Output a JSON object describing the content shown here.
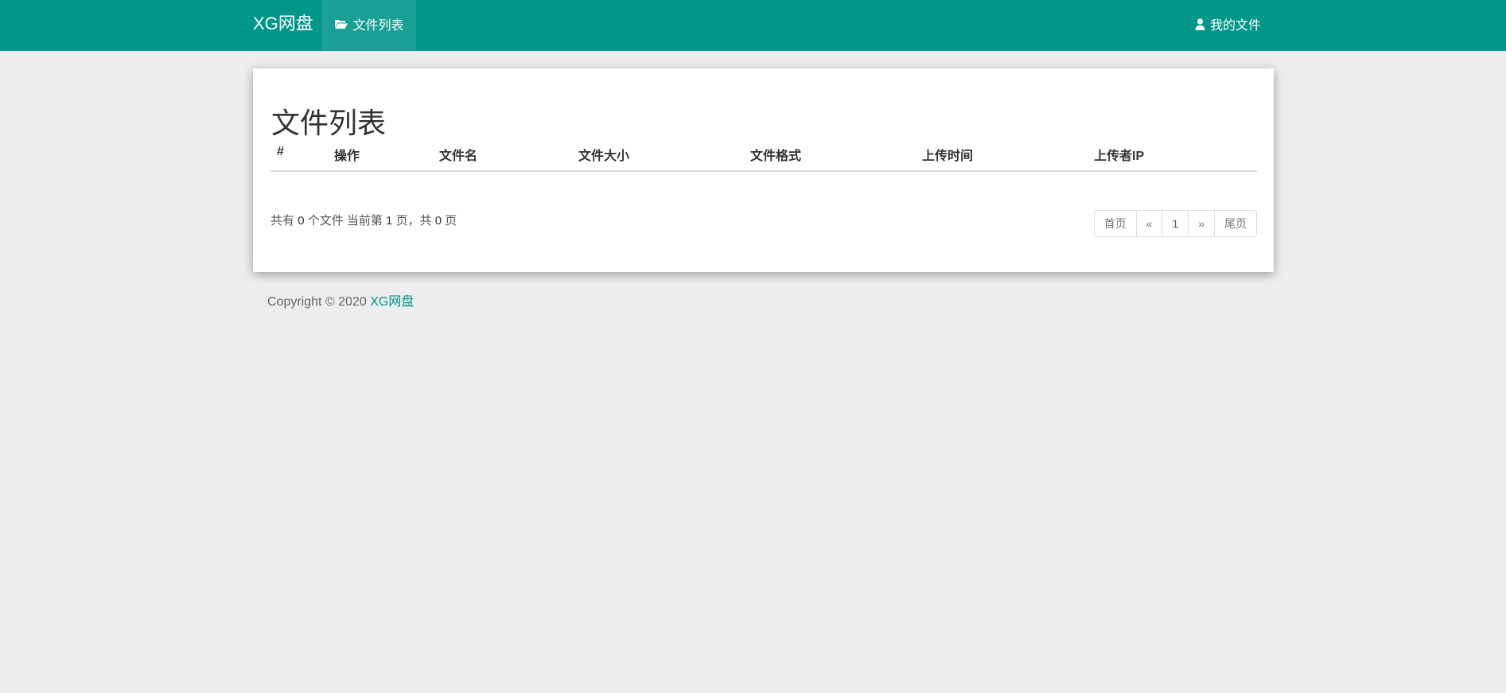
{
  "navbar": {
    "brand": "XG网盘",
    "tab_label": "文件列表",
    "tab_icon": "folder-open-icon",
    "right_label": "我的文件",
    "right_icon": "user-icon",
    "bg_color": "#009688"
  },
  "main": {
    "title": "文件列表",
    "columns": [
      "#",
      "操作",
      "文件名",
      "文件大小",
      "文件格式",
      "上传时间",
      "上传者IP"
    ],
    "summary": {
      "prefix": "共有",
      "total_files": "0",
      "files_suffix": "个文件  当前第",
      "current_page": "1",
      "page_mid": "页，共",
      "total_pages": "0",
      "page_suffix": "页"
    },
    "pagination": {
      "first": "首页",
      "prev": "«",
      "current": "1",
      "next": "»",
      "last": "尾页"
    }
  },
  "footer": {
    "copyright": "Copyright © 2020",
    "link": "XG网盘",
    "link_color": "#009688"
  }
}
